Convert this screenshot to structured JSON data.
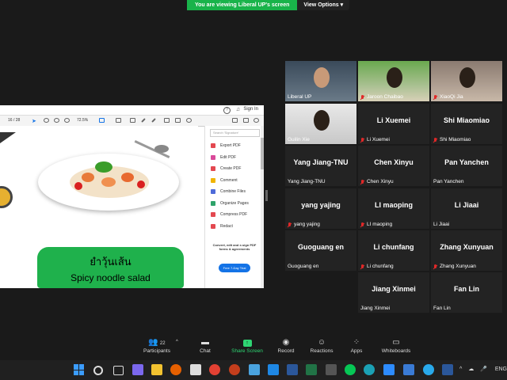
{
  "banner": {
    "viewing": "You are viewing Liberal UP's screen",
    "view_options": "View Options"
  },
  "pdf": {
    "sign_in": "Sign In",
    "page_indicator": "16 / 28",
    "zoom": "72.5%",
    "search_placeholder": "Search 'Signature'",
    "tools": [
      {
        "label": "Export PDF",
        "color": "#e34850"
      },
      {
        "label": "Edit PDF",
        "color": "#d94a9a"
      },
      {
        "label": "Create PDF",
        "color": "#e34850"
      },
      {
        "label": "Comment",
        "color": "#f0b400"
      },
      {
        "label": "Combine Files",
        "color": "#4e6bd9"
      },
      {
        "label": "Organize Pages",
        "color": "#2ea36a"
      },
      {
        "label": "Compress PDF",
        "color": "#e34850"
      },
      {
        "label": "Redact",
        "color": "#e34850"
      }
    ],
    "promo": "Convert, edit and e-sign PDF forms & agreements",
    "trial": "Free 7-Day Trial",
    "thai_text": "ยำวุ้นเส้น",
    "english_text": "Spicy noodle salad"
  },
  "participants": [
    {
      "name": "Liberal UP",
      "label": "Liberal UP",
      "video": true,
      "muted": false
    },
    {
      "name": "Jaroon Chaibao",
      "label": "Jaroon Chaibao",
      "video": true,
      "muted": true
    },
    {
      "name": "XiaoQi Jia",
      "label": "XiaoQi Jia",
      "video": true,
      "muted": true
    },
    {
      "name": "Guilin Xie",
      "label": "Guilin Xie",
      "video": true,
      "muted": false
    },
    {
      "name": "Li Xuemei",
      "label": "Li Xuemei",
      "video": false,
      "muted": true
    },
    {
      "name": "Shi Miaomiao",
      "label": "Shi Miaomiao",
      "video": false,
      "muted": true
    },
    {
      "name": "Yang Jiang-TNU",
      "label": "Yang Jiang-TNU",
      "video": false,
      "muted": false
    },
    {
      "name": "Chen Xinyu",
      "label": "Chen Xinyu",
      "video": false,
      "muted": true
    },
    {
      "name": "Pan Yanchen",
      "label": "Pan Yanchen",
      "video": false,
      "muted": false
    },
    {
      "name": "yang yajing",
      "label": "yang yajing",
      "video": false,
      "muted": true
    },
    {
      "name": "LI maoping",
      "label": "LI maoping",
      "video": false,
      "muted": true
    },
    {
      "name": "Li Jiaai",
      "label": "Li Jiaai",
      "video": false,
      "muted": false
    },
    {
      "name": "Guoguang en",
      "label": "Guoguang en",
      "video": false,
      "muted": false
    },
    {
      "name": "Li chunfang",
      "label": "Li chunfang",
      "video": false,
      "muted": true
    },
    {
      "name": "Zhang Xunyuan",
      "label": "Zhang Xunyuan",
      "video": false,
      "muted": true
    },
    {
      "name": "Jiang Xinmei",
      "label": "Jiang Xinmei",
      "video": false,
      "muted": false
    },
    {
      "name": "Fan Lin",
      "label": "Fan Lin",
      "video": false,
      "muted": false
    }
  ],
  "toolbar": {
    "participants_label": "Participants",
    "participants_count": "22",
    "chat": "Chat",
    "share": "Share Screen",
    "record": "Record",
    "reactions": "Reactions",
    "apps": "Apps",
    "whiteboards": "Whiteboards"
  },
  "taskbar": {
    "lang": "ENG"
  },
  "colors": {
    "share_green": "#2ed573",
    "banner_green": "#19b34a",
    "muted_red": "#e02828"
  }
}
